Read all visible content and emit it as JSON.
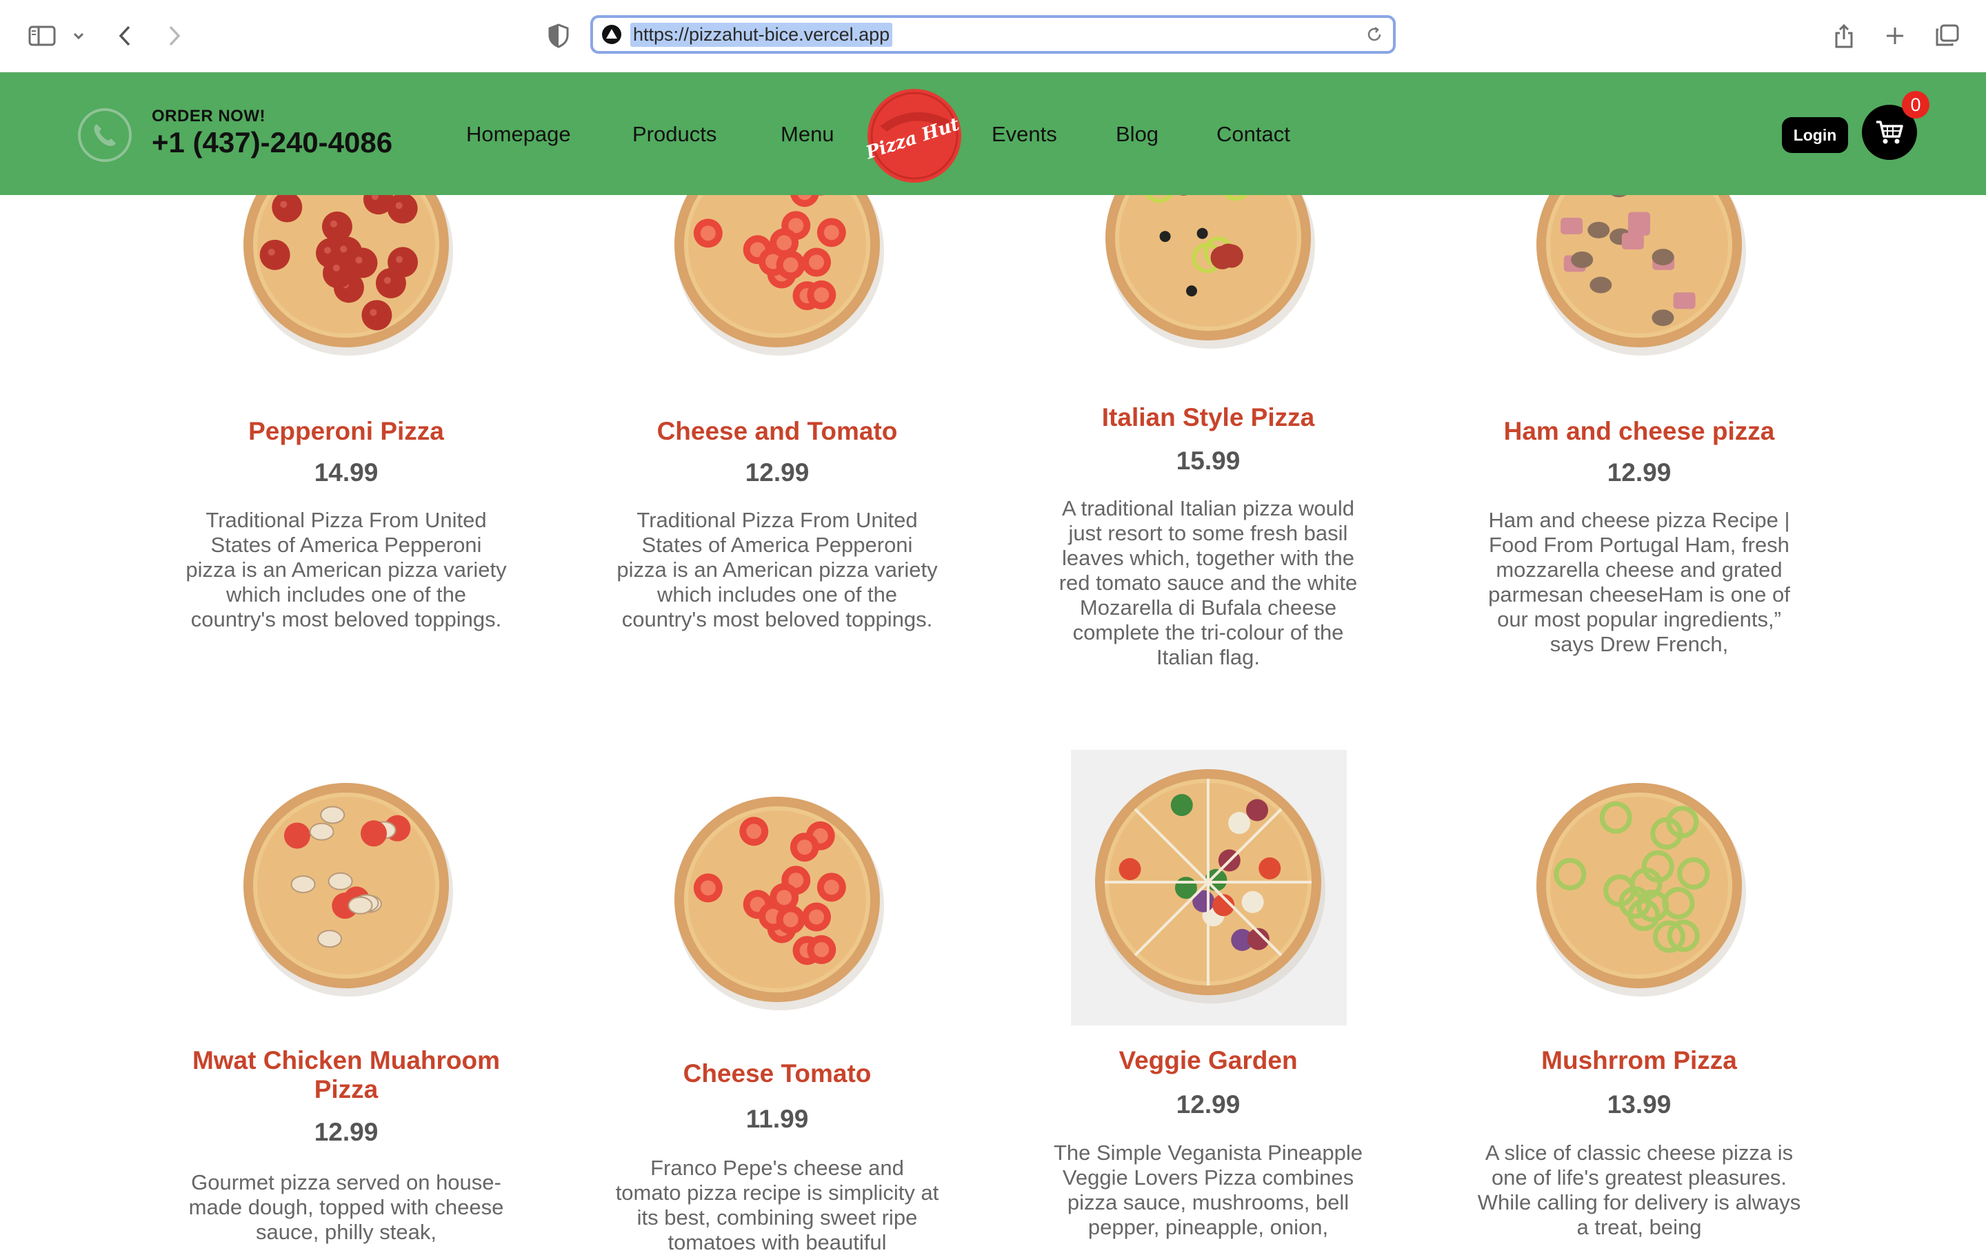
{
  "browser": {
    "url": "https://pizzahut-bice.vercel.app"
  },
  "header": {
    "order_label": "ORDER NOW!",
    "phone": "+1 (437)-240-4086",
    "nav": [
      "Homepage",
      "Products",
      "Menu",
      "Events",
      "Blog",
      "Contact"
    ],
    "logo_text": "Pizza Hut",
    "login": "Login",
    "cart_count": "0",
    "colors": {
      "header_bg": "#52ab5e",
      "accent_red": "#c8442b",
      "logo_red": "#e53a33"
    }
  },
  "products": [
    {
      "name": "Pepperoni Pizza",
      "price": "14.99",
      "topping": "pepperoni",
      "desc": "Traditional Pizza From United States of America Pepperoni pizza is an American pizza variety which includes one of the country's most beloved toppings."
    },
    {
      "name": "Cheese and Tomato",
      "price": "12.99",
      "topping": "tomato",
      "desc": "Traditional Pizza From United States of America Pepperoni pizza is an American pizza variety which includes one of the country's most beloved toppings."
    },
    {
      "name": "Italian Style Pizza",
      "price": "15.99",
      "topping": "italian",
      "desc": "A traditional Italian pizza would just resort to some fresh basil leaves which, together with the red tomato sauce and the white Mozarella di Bufala cheese complete the tri-colour of the Italian flag."
    },
    {
      "name": "Ham and cheese pizza",
      "price": "12.99",
      "topping": "ham",
      "desc": "Ham and cheese pizza Recipe | Food From Portugal Ham, fresh mozzarella cheese and grated parmesan cheeseHam is one of our most popular ingredients,” says Drew French,"
    },
    {
      "name": "Mwat Chicken Muahroom Pizza",
      "price": "12.99",
      "topping": "chicken",
      "desc": "Gourmet pizza served on house-made dough, topped with cheese sauce, philly steak,"
    },
    {
      "name": "Cheese Tomato",
      "price": "11.99",
      "topping": "tomato",
      "desc": "Franco Pepe's cheese and tomato pizza recipe is simplicity at its best, combining sweet ripe tomatoes with beautiful"
    },
    {
      "name": "Veggie Garden",
      "price": "12.99",
      "topping": "veggie",
      "desc": "The Simple Veganista Pineapple Veggie Lovers Pizza combines pizza sauce, mushrooms, bell pepper, pineapple, onion,"
    },
    {
      "name": "Mushrrom Pizza",
      "price": "13.99",
      "topping": "pepper",
      "desc": "A slice of classic cheese pizza is one of life's greatest pleasures. While calling for delivery is always a treat, being"
    }
  ]
}
